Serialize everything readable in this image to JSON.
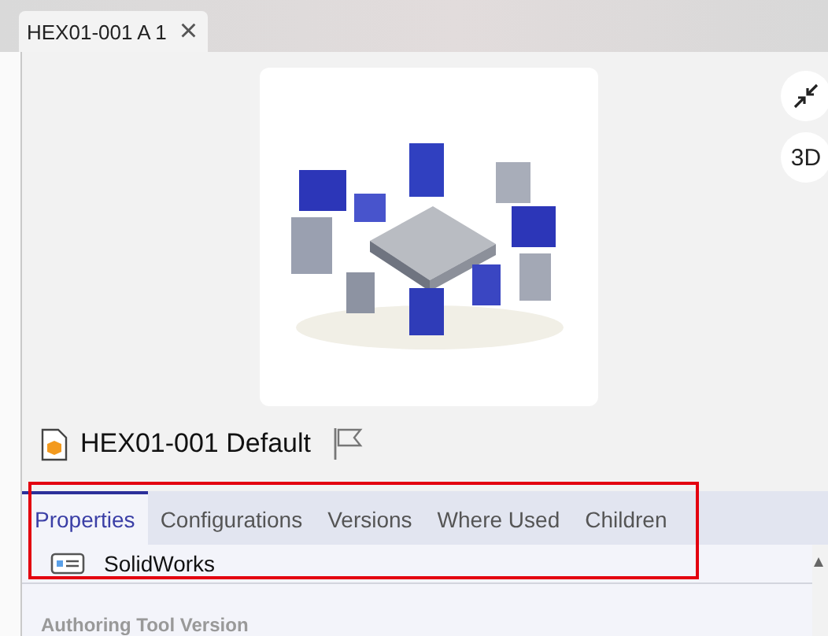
{
  "document_tab": {
    "label": "HEX01-001 A 1",
    "close": "×"
  },
  "viewer": {
    "view_button": "3D"
  },
  "item": {
    "title": "HEX01-001 Default",
    "flagged": false
  },
  "tabs": [
    {
      "label": "Properties",
      "selected": true
    },
    {
      "label": "Configurations",
      "selected": false
    },
    {
      "label": "Versions",
      "selected": false
    },
    {
      "label": "Where Used",
      "selected": false
    },
    {
      "label": "Children",
      "selected": false
    }
  ],
  "properties": {
    "authoring_tool": "SolidWorks",
    "next_label": "Authoring Tool Version"
  }
}
